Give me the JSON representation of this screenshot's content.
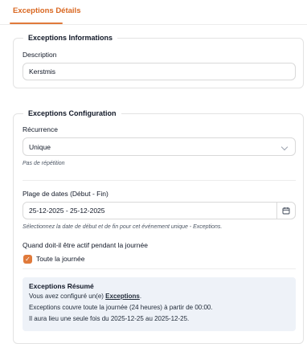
{
  "tabs": {
    "active_label": "Exceptions Détails"
  },
  "informations": {
    "legend": "Exceptions Informations",
    "description_label": "Description",
    "description_value": "Kerstmis"
  },
  "configuration": {
    "legend": "Exceptions Configuration",
    "recurrence_label": "Récurrence",
    "recurrence_value": "Unique",
    "recurrence_hint": "Pas de répétition",
    "date_range_label": "Plage de dates (Début - Fin)",
    "date_range_value": "25-12-2025 - 25-12-2025",
    "date_range_hint": "Sélectionnez la date de début et de fin pour cet événement unique - Exceptions.",
    "active_time_label": "Quand doit-il être actif pendant la journée",
    "all_day_label": "Toute la journée",
    "all_day_checked": true
  },
  "summary": {
    "title": "Exceptions Résumé",
    "line1_prefix": "Vous avez configuré un(e) ",
    "line1_link": "Exceptions",
    "line1_suffix": ".",
    "line2": "Exceptions couvre toute la journée (24 heures) à partir de 00:00.",
    "line3": "Il aura lieu une seule fois du 2025-12-25 au 2025-12-25."
  },
  "icons": {
    "dropdown": "chevron-down-icon",
    "calendar": "calendar-icon",
    "check": "checkmark-icon"
  },
  "colors": {
    "accent": "#e07a3b",
    "summary_bg": "#eef2f8"
  }
}
